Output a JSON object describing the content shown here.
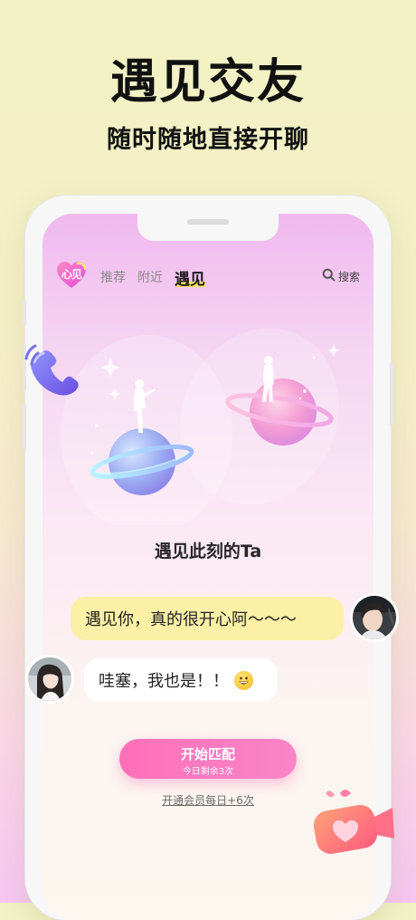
{
  "promo": {
    "headline": "遇见交友",
    "subheadline": "随时随地直接开聊"
  },
  "app": {
    "logo_text": "心见",
    "tabs": [
      {
        "label": "推荐"
      },
      {
        "label": "附近"
      },
      {
        "label": "遇见",
        "active": true
      }
    ],
    "search_label": "搜索"
  },
  "main": {
    "title": "遇见此刻的Ta",
    "chat": [
      {
        "from": "other",
        "text": "遇见你，真的很开心阿～～～",
        "bubble_color": "#fbf0a6"
      },
      {
        "from": "self",
        "text": "哇塞，我也是！！",
        "emoji": "grinning-face",
        "bubble_color": "#ffffff"
      }
    ],
    "cta": {
      "label": "开始匹配",
      "sub_label": "今日剩余3次"
    },
    "vip_link": "开通会员每日+6次"
  },
  "colors": {
    "accent_pink": "#ff6fb8",
    "tab_underline": "#f6e25a",
    "bubble_yellow": "#fbf0a6"
  },
  "icons": [
    "logo-heart-icon",
    "search-icon",
    "phone-call-icon",
    "video-camera-icon",
    "planet-left-icon",
    "planet-right-icon"
  ]
}
